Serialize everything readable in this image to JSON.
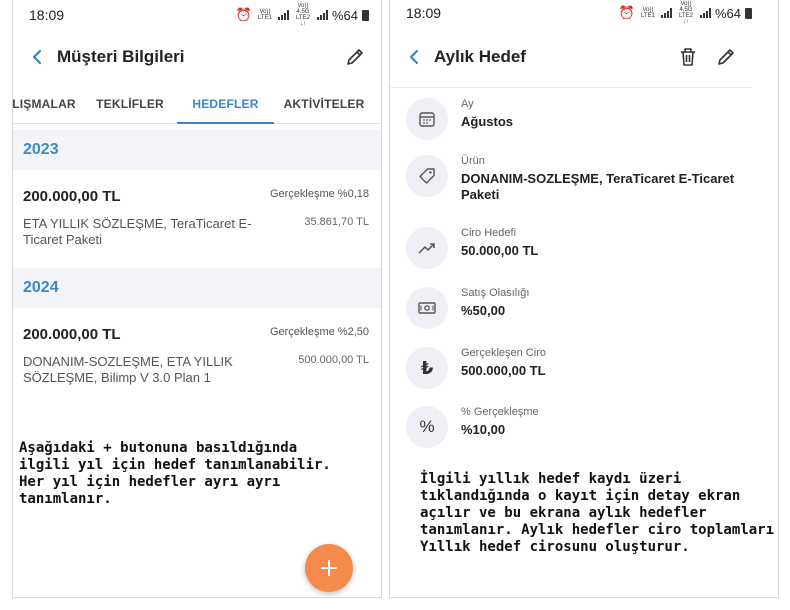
{
  "left": {
    "status": {
      "time": "18:09",
      "battery": "%64",
      "net1": "Vo)) LTE1",
      "net2": "Vo)) 4.5G LTE2 ↓↑"
    },
    "appbar": {
      "title": "Müşteri Bilgileri"
    },
    "tabs": [
      {
        "label": "LIŞMALAR"
      },
      {
        "label": "TEKLİFLER"
      },
      {
        "label": "HEDEFLER"
      },
      {
        "label": "AKTİVİTELER"
      }
    ],
    "years": [
      {
        "year": "2023",
        "amount": "200.000,00 TL",
        "pct": "Gerçekleşme %0,18",
        "desc": "ETA YILLIK SÖZLEŞME, TeraTicaret E-Ticaret Paketi",
        "actual": "35.861,70 TL"
      },
      {
        "year": "2024",
        "amount": "200.000,00 TL",
        "pct": "Gerçekleşme %2,50",
        "desc": "DONANIM-SOZLEŞME, ETA YILLIK SÖZLEŞME, Bilimp V 3.0 Plan 1",
        "actual": "500.000,00 TL"
      }
    ],
    "note": "Aşağıdaki + butonuna basıldığında ilgili yıl için hedef tanımlanabilir. Her yıl için hedefler ayrı ayrı tanımlanır.",
    "fab": {
      "label": "+"
    }
  },
  "right": {
    "status": {
      "time": "18:09",
      "battery": "%64",
      "net1": "Vo)) LTE1",
      "net2": "Vo)) 4.5G LTE2 ↓↑"
    },
    "appbar": {
      "title": "Aylık Hedef"
    },
    "fields": [
      {
        "label": "Ay",
        "value": "Ağustos",
        "icon": "calendar-icon"
      },
      {
        "label": "Ürün",
        "value": "DONANIM-SOZLEŞME, TeraTicaret  E-Ticaret Paketi",
        "icon": "tag-icon"
      },
      {
        "label": "Ciro Hedefi",
        "value": "50.000,00 TL",
        "icon": "trend-up-icon"
      },
      {
        "label": "Satış Olasılığı",
        "value": "%50,00",
        "icon": "banknote-icon"
      },
      {
        "label": "Gerçekleşen Ciro",
        "value": "500.000,00 TL",
        "icon": "lira-icon",
        "glyph": "₺"
      },
      {
        "label": "% Gerçekleşme",
        "value": "%10,00",
        "icon": "percent-icon",
        "glyph": "%"
      }
    ],
    "note": "İlgili yıllık hedef kaydı üzeri tıklandığında o kayıt için detay ekran açılır ve bu ekrana aylık hedefler tanımlanır. Aylık hedefler ciro toplamları Yıllık hedef cirosunu oluşturur."
  },
  "colors": {
    "accent": "#3a84c4",
    "fab": "#f58a4c",
    "year_bg": "#f2f4f7"
  }
}
